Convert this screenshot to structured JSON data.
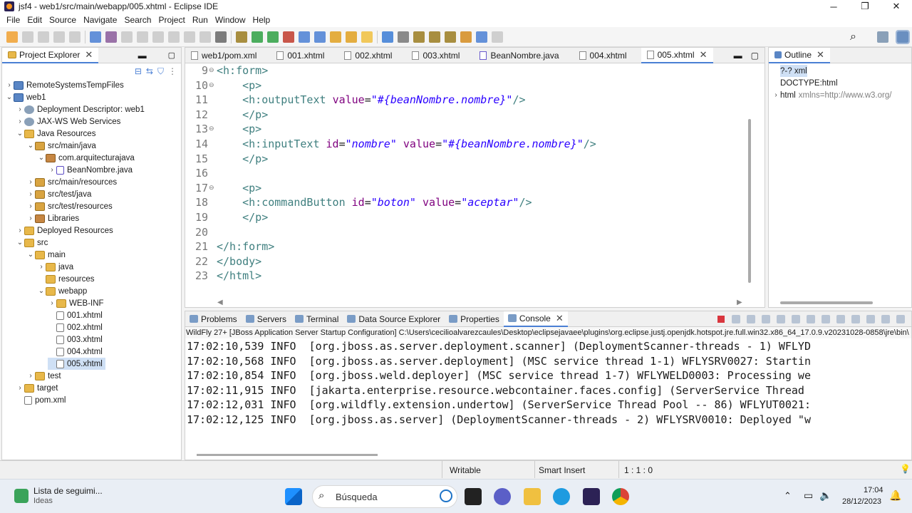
{
  "window": {
    "title": "jsf4 - web1/src/main/webapp/005.xhtml - Eclipse IDE",
    "minimize": "─",
    "maximize": "❐",
    "close": "✕"
  },
  "menu": [
    "File",
    "Edit",
    "Source",
    "Navigate",
    "Search",
    "Project",
    "Run",
    "Window",
    "Help"
  ],
  "project_explorer": {
    "title": "Project Explorer",
    "items": [
      {
        "label": "RemoteSystemsTempFiles",
        "arrow": "›",
        "icon": "proj",
        "indent": 0
      },
      {
        "label": "web1",
        "arrow": "⌄",
        "icon": "proj",
        "indent": 0
      },
      {
        "label": "Deployment Descriptor: web1",
        "arrow": "›",
        "icon": "gear",
        "indent": 1
      },
      {
        "label": "JAX-WS Web Services",
        "arrow": "›",
        "icon": "gear",
        "indent": 1
      },
      {
        "label": "Java Resources",
        "arrow": "⌄",
        "icon": "folder",
        "indent": 1
      },
      {
        "label": "src/main/java",
        "arrow": "⌄",
        "icon": "srcf",
        "indent": 2
      },
      {
        "label": "com.arquitecturajava",
        "arrow": "⌄",
        "icon": "pkg",
        "indent": 3
      },
      {
        "label": "BeanNombre.java",
        "arrow": "›",
        "icon": "jfile",
        "indent": 4
      },
      {
        "label": "src/main/resources",
        "arrow": "›",
        "icon": "srcf",
        "indent": 2
      },
      {
        "label": "src/test/java",
        "arrow": "›",
        "icon": "srcf",
        "indent": 2
      },
      {
        "label": "src/test/resources",
        "arrow": "›",
        "icon": "srcf",
        "indent": 2
      },
      {
        "label": "Libraries",
        "arrow": "›",
        "icon": "pkg",
        "indent": 2
      },
      {
        "label": "Deployed Resources",
        "arrow": "›",
        "icon": "folder",
        "indent": 1
      },
      {
        "label": "src",
        "arrow": "⌄",
        "icon": "folder",
        "indent": 1
      },
      {
        "label": "main",
        "arrow": "⌄",
        "icon": "folder",
        "indent": 2
      },
      {
        "label": "java",
        "arrow": "›",
        "icon": "folder",
        "indent": 3
      },
      {
        "label": "resources",
        "arrow": "",
        "icon": "folder",
        "indent": 3
      },
      {
        "label": "webapp",
        "arrow": "⌄",
        "icon": "folder",
        "indent": 3
      },
      {
        "label": "WEB-INF",
        "arrow": "›",
        "icon": "folder",
        "indent": 4
      },
      {
        "label": "001.xhtml",
        "arrow": "",
        "icon": "file",
        "indent": 4
      },
      {
        "label": "002.xhtml",
        "arrow": "",
        "icon": "file",
        "indent": 4
      },
      {
        "label": "003.xhtml",
        "arrow": "",
        "icon": "file",
        "indent": 4
      },
      {
        "label": "004.xhtml",
        "arrow": "",
        "icon": "file",
        "indent": 4
      },
      {
        "label": "005.xhtml",
        "arrow": "",
        "icon": "file",
        "indent": 4,
        "selected": true
      },
      {
        "label": "test",
        "arrow": "›",
        "icon": "folder",
        "indent": 2
      },
      {
        "label": "target",
        "arrow": "›",
        "icon": "folder",
        "indent": 1
      },
      {
        "label": "pom.xml",
        "arrow": "",
        "icon": "file",
        "indent": 1
      }
    ]
  },
  "editor": {
    "tabs": [
      {
        "label": "web1/pom.xml",
        "icon": "file"
      },
      {
        "label": "001.xhtml",
        "icon": "file"
      },
      {
        "label": "002.xhtml",
        "icon": "file"
      },
      {
        "label": "003.xhtml",
        "icon": "file"
      },
      {
        "label": "BeanNombre.java",
        "icon": "jfile"
      },
      {
        "label": "004.xhtml",
        "icon": "file"
      },
      {
        "label": "005.xhtml",
        "icon": "file",
        "active": true
      }
    ],
    "lines": [
      {
        "n": "9",
        "fold": "⊖",
        "segs": [
          [
            "tag",
            "<h:form>"
          ]
        ]
      },
      {
        "n": "10",
        "fold": "⊖",
        "segs": [
          [
            "",
            "    "
          ],
          [
            "tag",
            "<p>"
          ]
        ]
      },
      {
        "n": "11",
        "fold": "",
        "segs": [
          [
            "",
            "    "
          ],
          [
            "tag",
            "<h:outputText "
          ],
          [
            "attr",
            "value"
          ],
          [
            "",
            "="
          ],
          [
            "str",
            "\"#{beanNombre.nombre}\""
          ],
          [
            "tag",
            "/>"
          ]
        ]
      },
      {
        "n": "12",
        "fold": "",
        "segs": [
          [
            "",
            "    "
          ],
          [
            "tag",
            "</p>"
          ]
        ]
      },
      {
        "n": "13",
        "fold": "⊖",
        "segs": [
          [
            "",
            "    "
          ],
          [
            "tag",
            "<p>"
          ]
        ]
      },
      {
        "n": "14",
        "fold": "",
        "segs": [
          [
            "",
            "    "
          ],
          [
            "tag",
            "<h:inputText "
          ],
          [
            "attr",
            "id"
          ],
          [
            "",
            "="
          ],
          [
            "str",
            "\"nombre\""
          ],
          [
            "attr",
            " value"
          ],
          [
            "",
            "="
          ],
          [
            "str",
            "\"#{beanNombre.nombre}\""
          ],
          [
            "tag",
            "/>"
          ]
        ]
      },
      {
        "n": "15",
        "fold": "",
        "segs": [
          [
            "",
            "    "
          ],
          [
            "tag",
            "</p>"
          ]
        ]
      },
      {
        "n": "16",
        "fold": "",
        "segs": []
      },
      {
        "n": "17",
        "fold": "⊖",
        "segs": [
          [
            "",
            "    "
          ],
          [
            "tag",
            "<p>"
          ]
        ]
      },
      {
        "n": "18",
        "fold": "",
        "segs": [
          [
            "",
            "    "
          ],
          [
            "tag",
            "<h:commandButton "
          ],
          [
            "attr",
            "id"
          ],
          [
            "",
            "="
          ],
          [
            "str",
            "\"boton\""
          ],
          [
            "attr",
            " value"
          ],
          [
            "",
            "="
          ],
          [
            "str",
            "\"aceptar\""
          ],
          [
            "tag",
            "/>"
          ]
        ]
      },
      {
        "n": "19",
        "fold": "",
        "segs": [
          [
            "",
            "    "
          ],
          [
            "tag",
            "</p>"
          ]
        ]
      },
      {
        "n": "20",
        "fold": "",
        "segs": []
      },
      {
        "n": "21",
        "fold": "",
        "segs": [
          [
            "tag",
            "</h:form>"
          ]
        ]
      },
      {
        "n": "22",
        "fold": "",
        "segs": [
          [
            "tag",
            "</body>"
          ]
        ]
      },
      {
        "n": "23",
        "fold": "",
        "segs": [
          [
            "tag",
            "</html>"
          ]
        ]
      }
    ]
  },
  "outline": {
    "title": "Outline",
    "items": [
      {
        "label": "?-? xml",
        "sub": ""
      },
      {
        "label": "DOCTYPE:html",
        "sub": ""
      },
      {
        "label": "html",
        "sub": "xmlns=http://www.w3.org/"
      }
    ]
  },
  "console": {
    "tabs": [
      "Problems",
      "Servers",
      "Terminal",
      "Data Source Explorer",
      "Properties",
      "Console"
    ],
    "header": "WildFly 27+ [JBoss Application Server Startup Configuration] C:\\Users\\cecilioalvarezcaules\\Desktop\\eclipsejavaee\\plugins\\org.eclipse.justj.openjdk.hotspot.jre.full.win32.x86_64_17.0.9.v20231028-0858\\jre\\bin\\",
    "lines": [
      "17:02:10,539 INFO  [org.jboss.as.server.deployment.scanner] (DeploymentScanner-threads - 1) WFLYD",
      "17:02:10,568 INFO  [org.jboss.as.server.deployment] (MSC service thread 1-1) WFLYSRV0027: Startin",
      "17:02:10,854 INFO  [org.jboss.weld.deployer] (MSC service thread 1-7) WFLYWELD0003: Processing we",
      "17:02:11,915 INFO  [jakarta.enterprise.resource.webcontainer.faces.config] (ServerService Thread",
      "17:02:12,031 INFO  [org.wildfly.extension.undertow] (ServerService Thread Pool -- 86) WFLYUT0021:",
      "17:02:12,125 INFO  [org.jboss.as.server] (DeploymentScanner-threads - 2) WFLYSRV0010: Deployed \"w"
    ]
  },
  "status": {
    "writable": "Writable",
    "insert": "Smart Insert",
    "position": "1 : 1 : 0"
  },
  "taskbar": {
    "widget_title": "Lista de seguimi...",
    "widget_sub": "Ideas",
    "search": "Búsqueda",
    "time": "17:04",
    "date": "28/12/2023"
  }
}
